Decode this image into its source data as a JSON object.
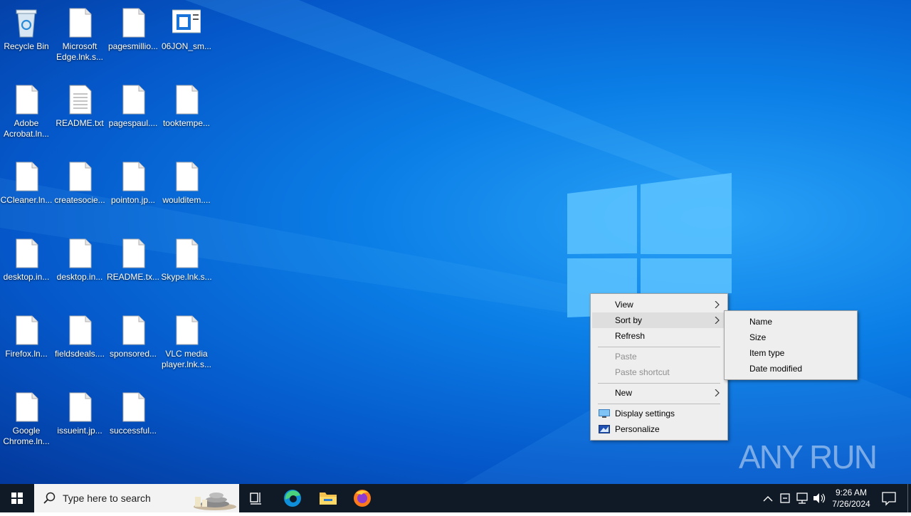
{
  "desktop": {
    "icons": [
      {
        "label": "Recycle Bin",
        "type": "recycle"
      },
      {
        "label": "Microsoft Edge.lnk.s...",
        "type": "file"
      },
      {
        "label": "pagesmillio...",
        "type": "file"
      },
      {
        "label": "06JON_sm...",
        "type": "image"
      },
      {
        "label": "Adobe Acrobat.ln...",
        "type": "file"
      },
      {
        "label": "README.txt",
        "type": "text"
      },
      {
        "label": "pagespaul....",
        "type": "file"
      },
      {
        "label": "tooktempe...",
        "type": "file"
      },
      {
        "label": "CCleaner.ln...",
        "type": "file"
      },
      {
        "label": "createsocie...",
        "type": "file"
      },
      {
        "label": "pointon.jp...",
        "type": "file"
      },
      {
        "label": "woulditem....",
        "type": "file"
      },
      {
        "label": "desktop.in...",
        "type": "file"
      },
      {
        "label": "desktop.in...",
        "type": "file"
      },
      {
        "label": "README.tx...",
        "type": "file"
      },
      {
        "label": "Skype.lnk.s...",
        "type": "file"
      },
      {
        "label": "Firefox.ln...",
        "type": "file"
      },
      {
        "label": "fieldsdeals....",
        "type": "file"
      },
      {
        "label": "sponsored...",
        "type": "file"
      },
      {
        "label": "VLC media player.lnk.s...",
        "type": "file"
      },
      {
        "label": "Google Chrome.ln...",
        "type": "file"
      },
      {
        "label": "issueint.jp...",
        "type": "file"
      },
      {
        "label": "successful...",
        "type": "file"
      }
    ]
  },
  "context_menu": {
    "items": {
      "view": "View",
      "sort_by": "Sort by",
      "refresh": "Refresh",
      "paste": "Paste",
      "paste_shortcut": "Paste shortcut",
      "new": "New",
      "display_settings": "Display settings",
      "personalize": "Personalize"
    },
    "highlighted": "Sort by"
  },
  "sort_submenu": {
    "items": [
      "Name",
      "Size",
      "Item type",
      "Date modified"
    ]
  },
  "taskbar": {
    "search_placeholder": "Type here to search",
    "time": "9:26 AM",
    "date": "7/26/2024",
    "pinned": [
      "task-view-icon",
      "edge-icon",
      "file-explorer-icon",
      "firefox-icon"
    ]
  },
  "watermark": "ANY RUN",
  "colors": {
    "taskbar": "#101a27",
    "menu_bg": "#eeeeee",
    "menu_highlight": "#dedede",
    "desktop_blue": "#0b7ee6"
  }
}
